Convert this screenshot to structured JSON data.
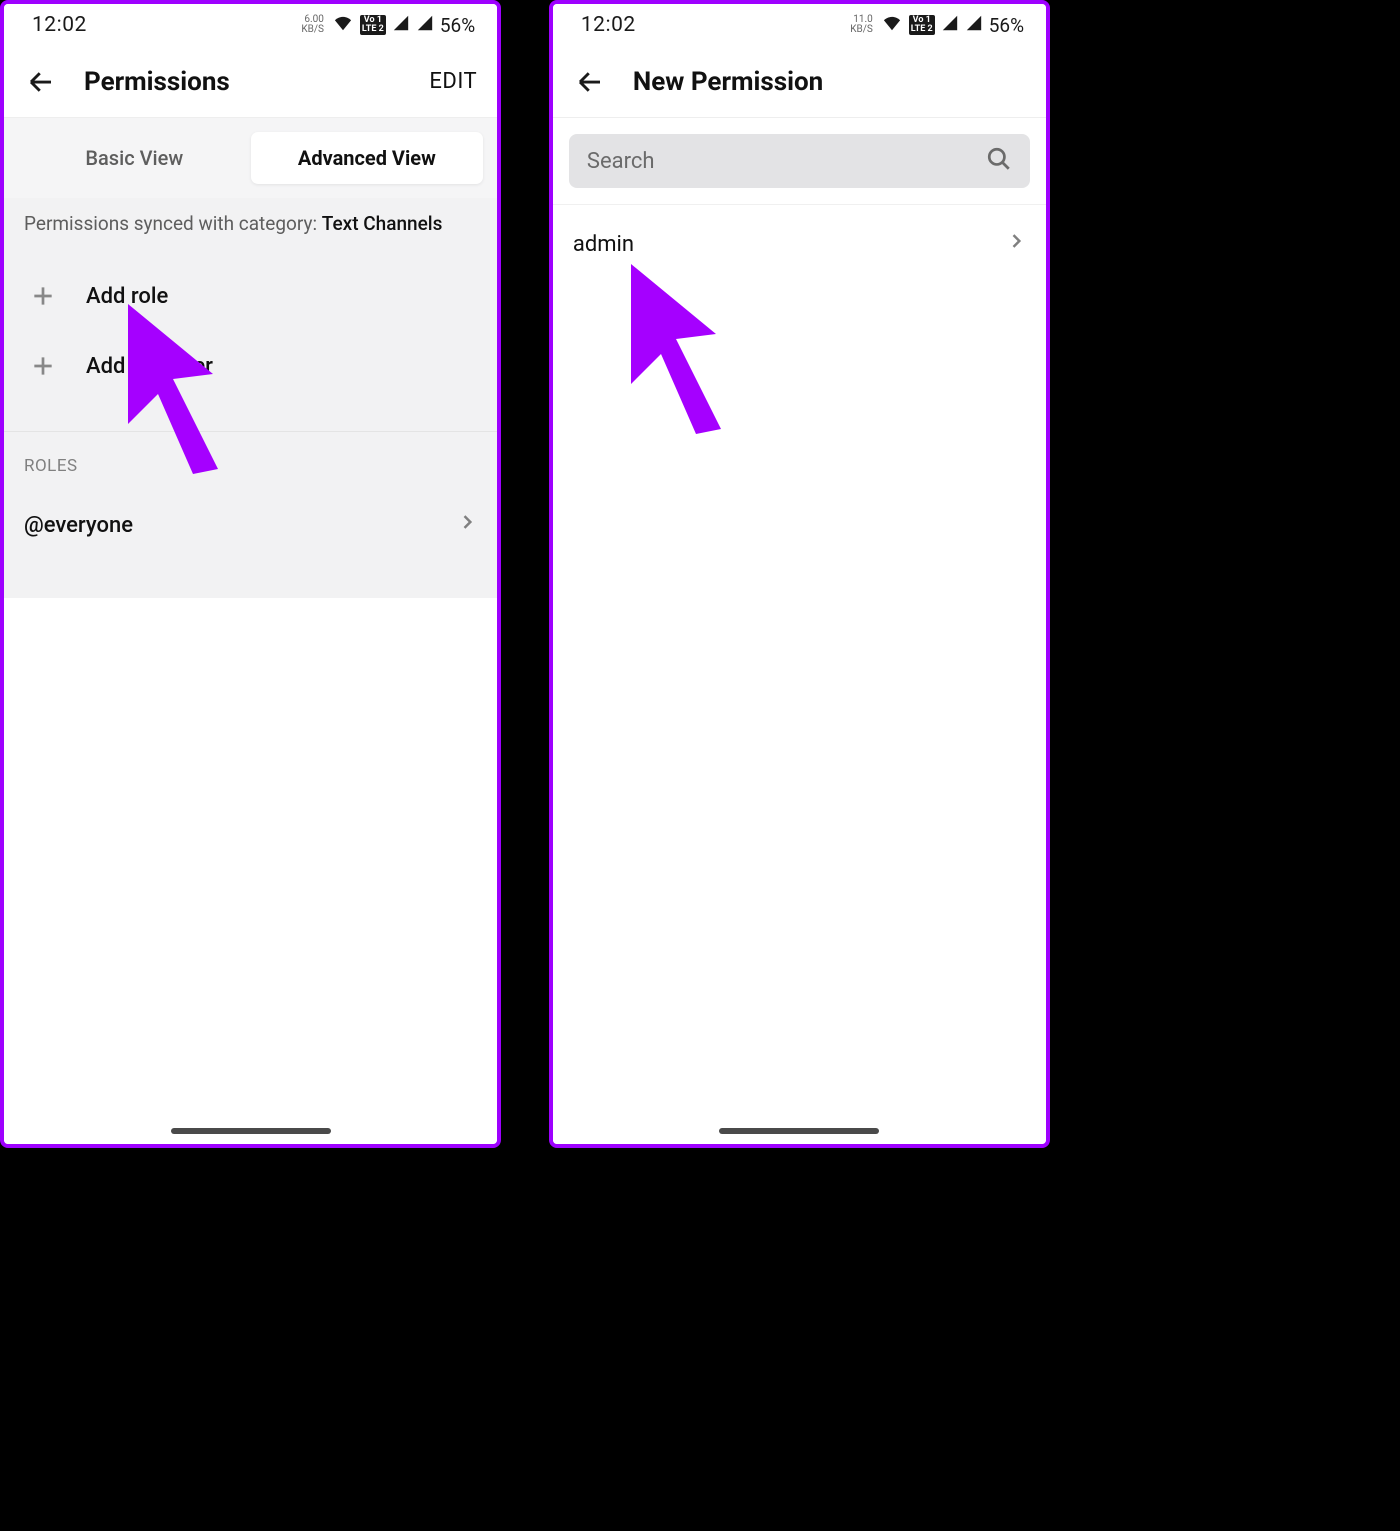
{
  "left": {
    "status": {
      "time": "12:02",
      "kbs_value": "6.00",
      "kbs_label": "KB/S",
      "lte1": "Vo 1",
      "lte2": "LTE 2",
      "battery": "56%"
    },
    "header": {
      "title": "Permissions",
      "edit": "EDIT"
    },
    "tabs": {
      "basic": "Basic View",
      "advanced": "Advanced View"
    },
    "sync": {
      "prefix": "Permissions synced with category: ",
      "category": "Text Channels"
    },
    "add": {
      "role": "Add role",
      "member": "Add member"
    },
    "roles": {
      "title": "ROLES",
      "items": [
        {
          "label": "@everyone"
        }
      ]
    }
  },
  "right": {
    "status": {
      "time": "12:02",
      "kbs_value": "11.0",
      "kbs_label": "KB/S",
      "lte1": "Vo 1",
      "lte2": "LTE 2",
      "battery": "56%"
    },
    "header": {
      "title": "New Permission"
    },
    "search": {
      "placeholder": "Search"
    },
    "results": [
      {
        "label": "admin"
      }
    ]
  }
}
